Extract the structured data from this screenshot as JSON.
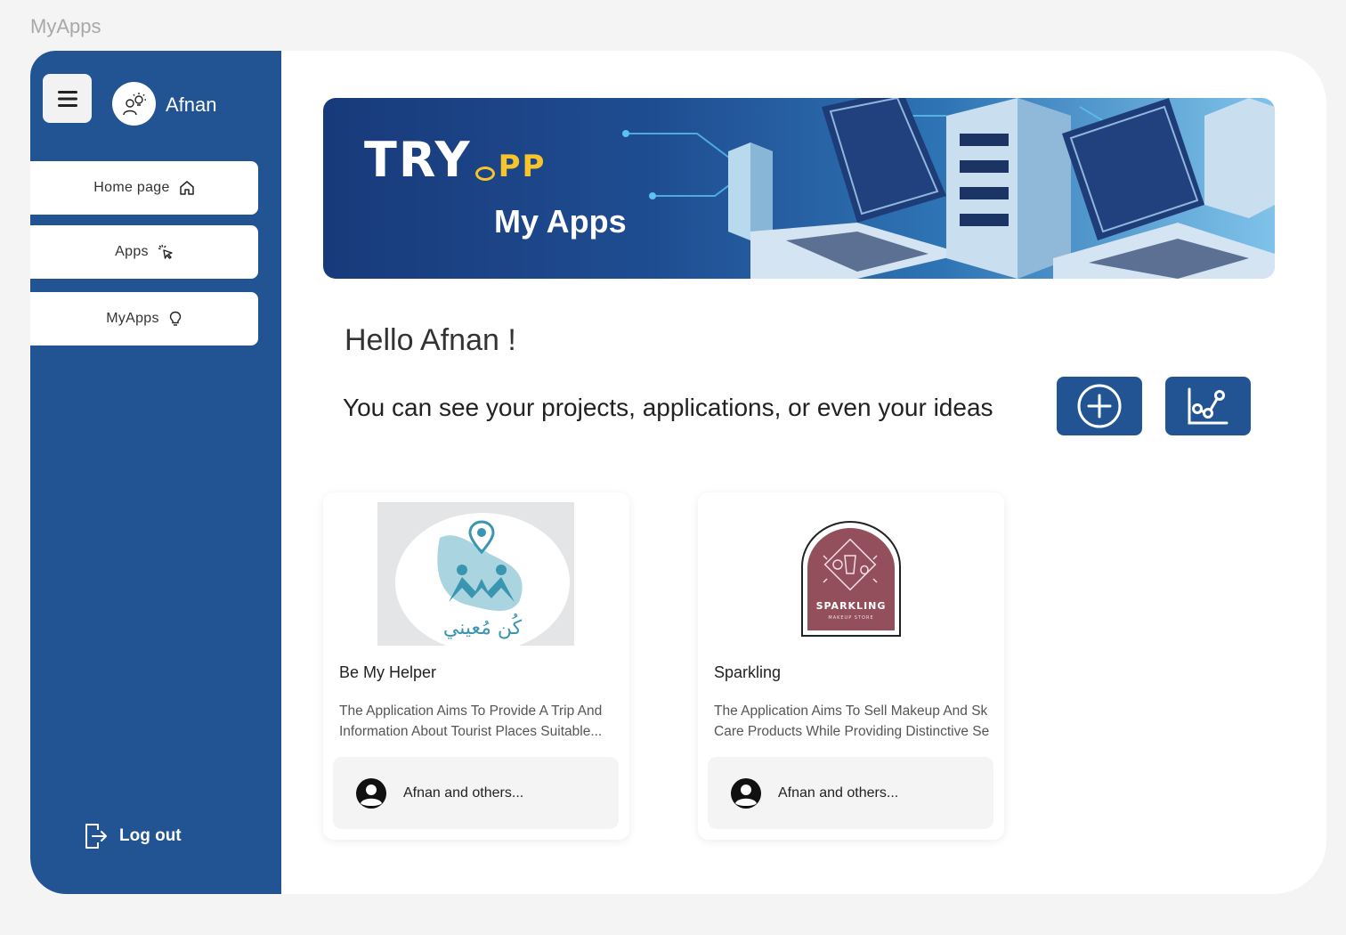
{
  "page_label": "MyApps",
  "sidebar": {
    "username": "Afnan",
    "items": [
      {
        "label": "Home page",
        "icon": "home-icon"
      },
      {
        "label": "Apps",
        "icon": "click-icon"
      },
      {
        "label": "MyApps",
        "icon": "lightbulb-icon"
      }
    ],
    "logout_label": "Log out"
  },
  "banner": {
    "brand_try": "TRY",
    "brand_app": "PP",
    "title": "My Apps"
  },
  "greeting": {
    "hello": "Hello Afnan !",
    "subtitle": "You can see your projects, applications, or even your ideas"
  },
  "actions": [
    {
      "icon": "add-icon"
    },
    {
      "icon": "analytics-icon"
    }
  ],
  "cards": [
    {
      "title": "Be My Helper",
      "desc_line1": "The Application Aims To Provide A Trip And",
      "desc_line2": "Information About Tourist Places Suitable...",
      "logo_text": "كُن مُعيني",
      "owner": "Afnan and others..."
    },
    {
      "title": "Sparkling",
      "desc_line1": "The Application Aims To Sell Makeup And Sk",
      "desc_line2": "Care Products While Providing Distinctive Se",
      "logo_text": "SPARKLING",
      "logo_subtext": "MAKEUP STORE",
      "owner": "Afnan and others..."
    }
  ],
  "colors": {
    "primary": "#225494",
    "background": "#f4f4f4",
    "accent": "#f7c52b"
  }
}
